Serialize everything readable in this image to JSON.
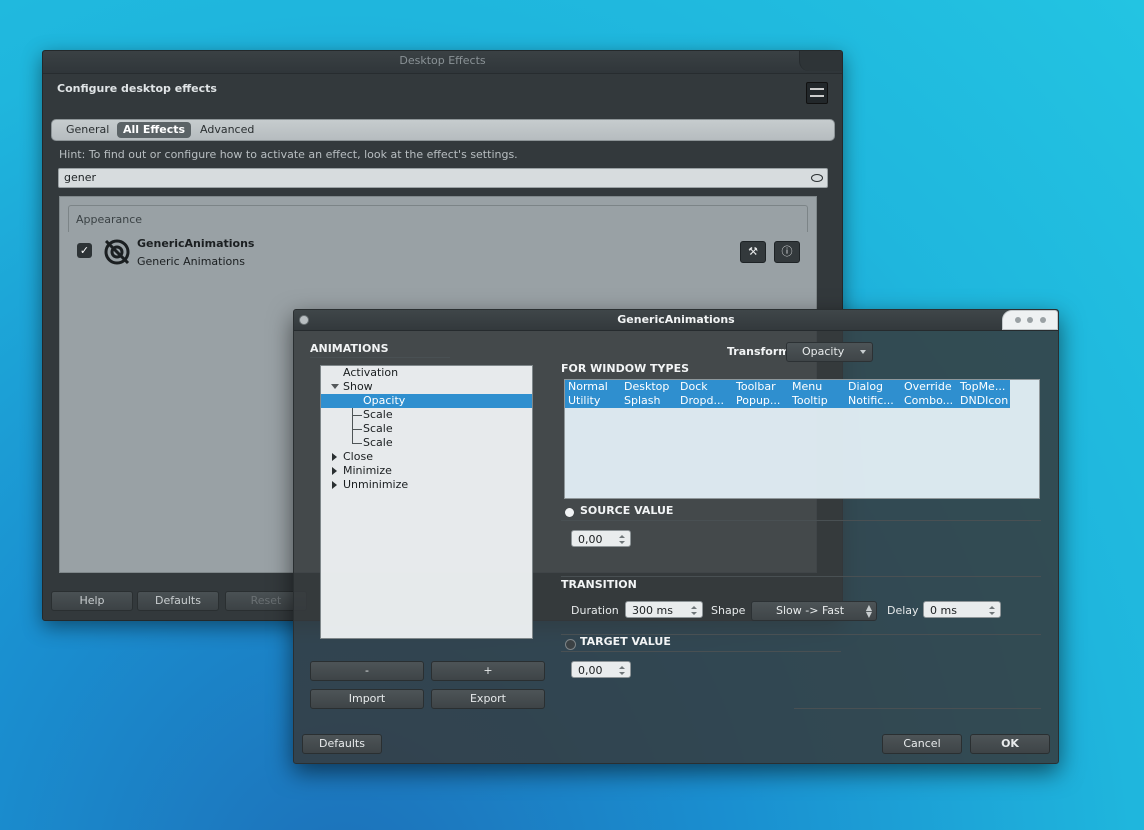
{
  "desktop_effects": {
    "title": "Desktop Effects",
    "header": "Configure desktop effects",
    "tabs": [
      "General",
      "All Effects",
      "Advanced"
    ],
    "active_tab": "All Effects",
    "hint": "Hint: To find out or configure how to activate an effect, look at the effect's settings.",
    "search_value": "gener",
    "group_label": "Appearance",
    "effect": {
      "name": "GenericAnimations",
      "description": "Generic Animations",
      "enabled": true
    },
    "buttons": {
      "help": "Help",
      "defaults": "Defaults",
      "reset": "Reset"
    }
  },
  "generic_animations": {
    "title": "GenericAnimations",
    "animations_label": "ANIMATIONS",
    "tree": {
      "activation": "Activation",
      "show": "Show",
      "show_children": [
        "Opacity",
        "Scale",
        "Scale",
        "Scale"
      ],
      "collapsed": [
        "Close",
        "Minimize",
        "Unminimize"
      ]
    },
    "list_buttons": {
      "remove": "-",
      "add": "+",
      "import": "Import",
      "export": "Export"
    },
    "transform_label": "Transform",
    "transform_value": "Opacity",
    "window_types_label": "FOR WINDOW TYPES",
    "window_types": [
      [
        "Normal",
        "Desktop",
        "Dock",
        "Toolbar",
        "Menu",
        "Dialog",
        "Override",
        "TopMe..."
      ],
      [
        "Utility",
        "Splash",
        "Dropd...",
        "Popup...",
        "Tooltip",
        "Notific...",
        "Combo...",
        "DNDIcon"
      ]
    ],
    "source_value_label": "SOURCE VALUE",
    "source_value": "0,00",
    "transition_label": "TRANSITION",
    "duration_label": "Duration",
    "duration_value": "300 ms",
    "shape_label": "Shape",
    "shape_value": "Slow -> Fast",
    "delay_label": "Delay",
    "delay_value": "0 ms",
    "target_value_label": "TARGET VALUE",
    "target_value": "0,00",
    "footer": {
      "defaults": "Defaults",
      "cancel": "Cancel",
      "ok": "OK"
    }
  }
}
